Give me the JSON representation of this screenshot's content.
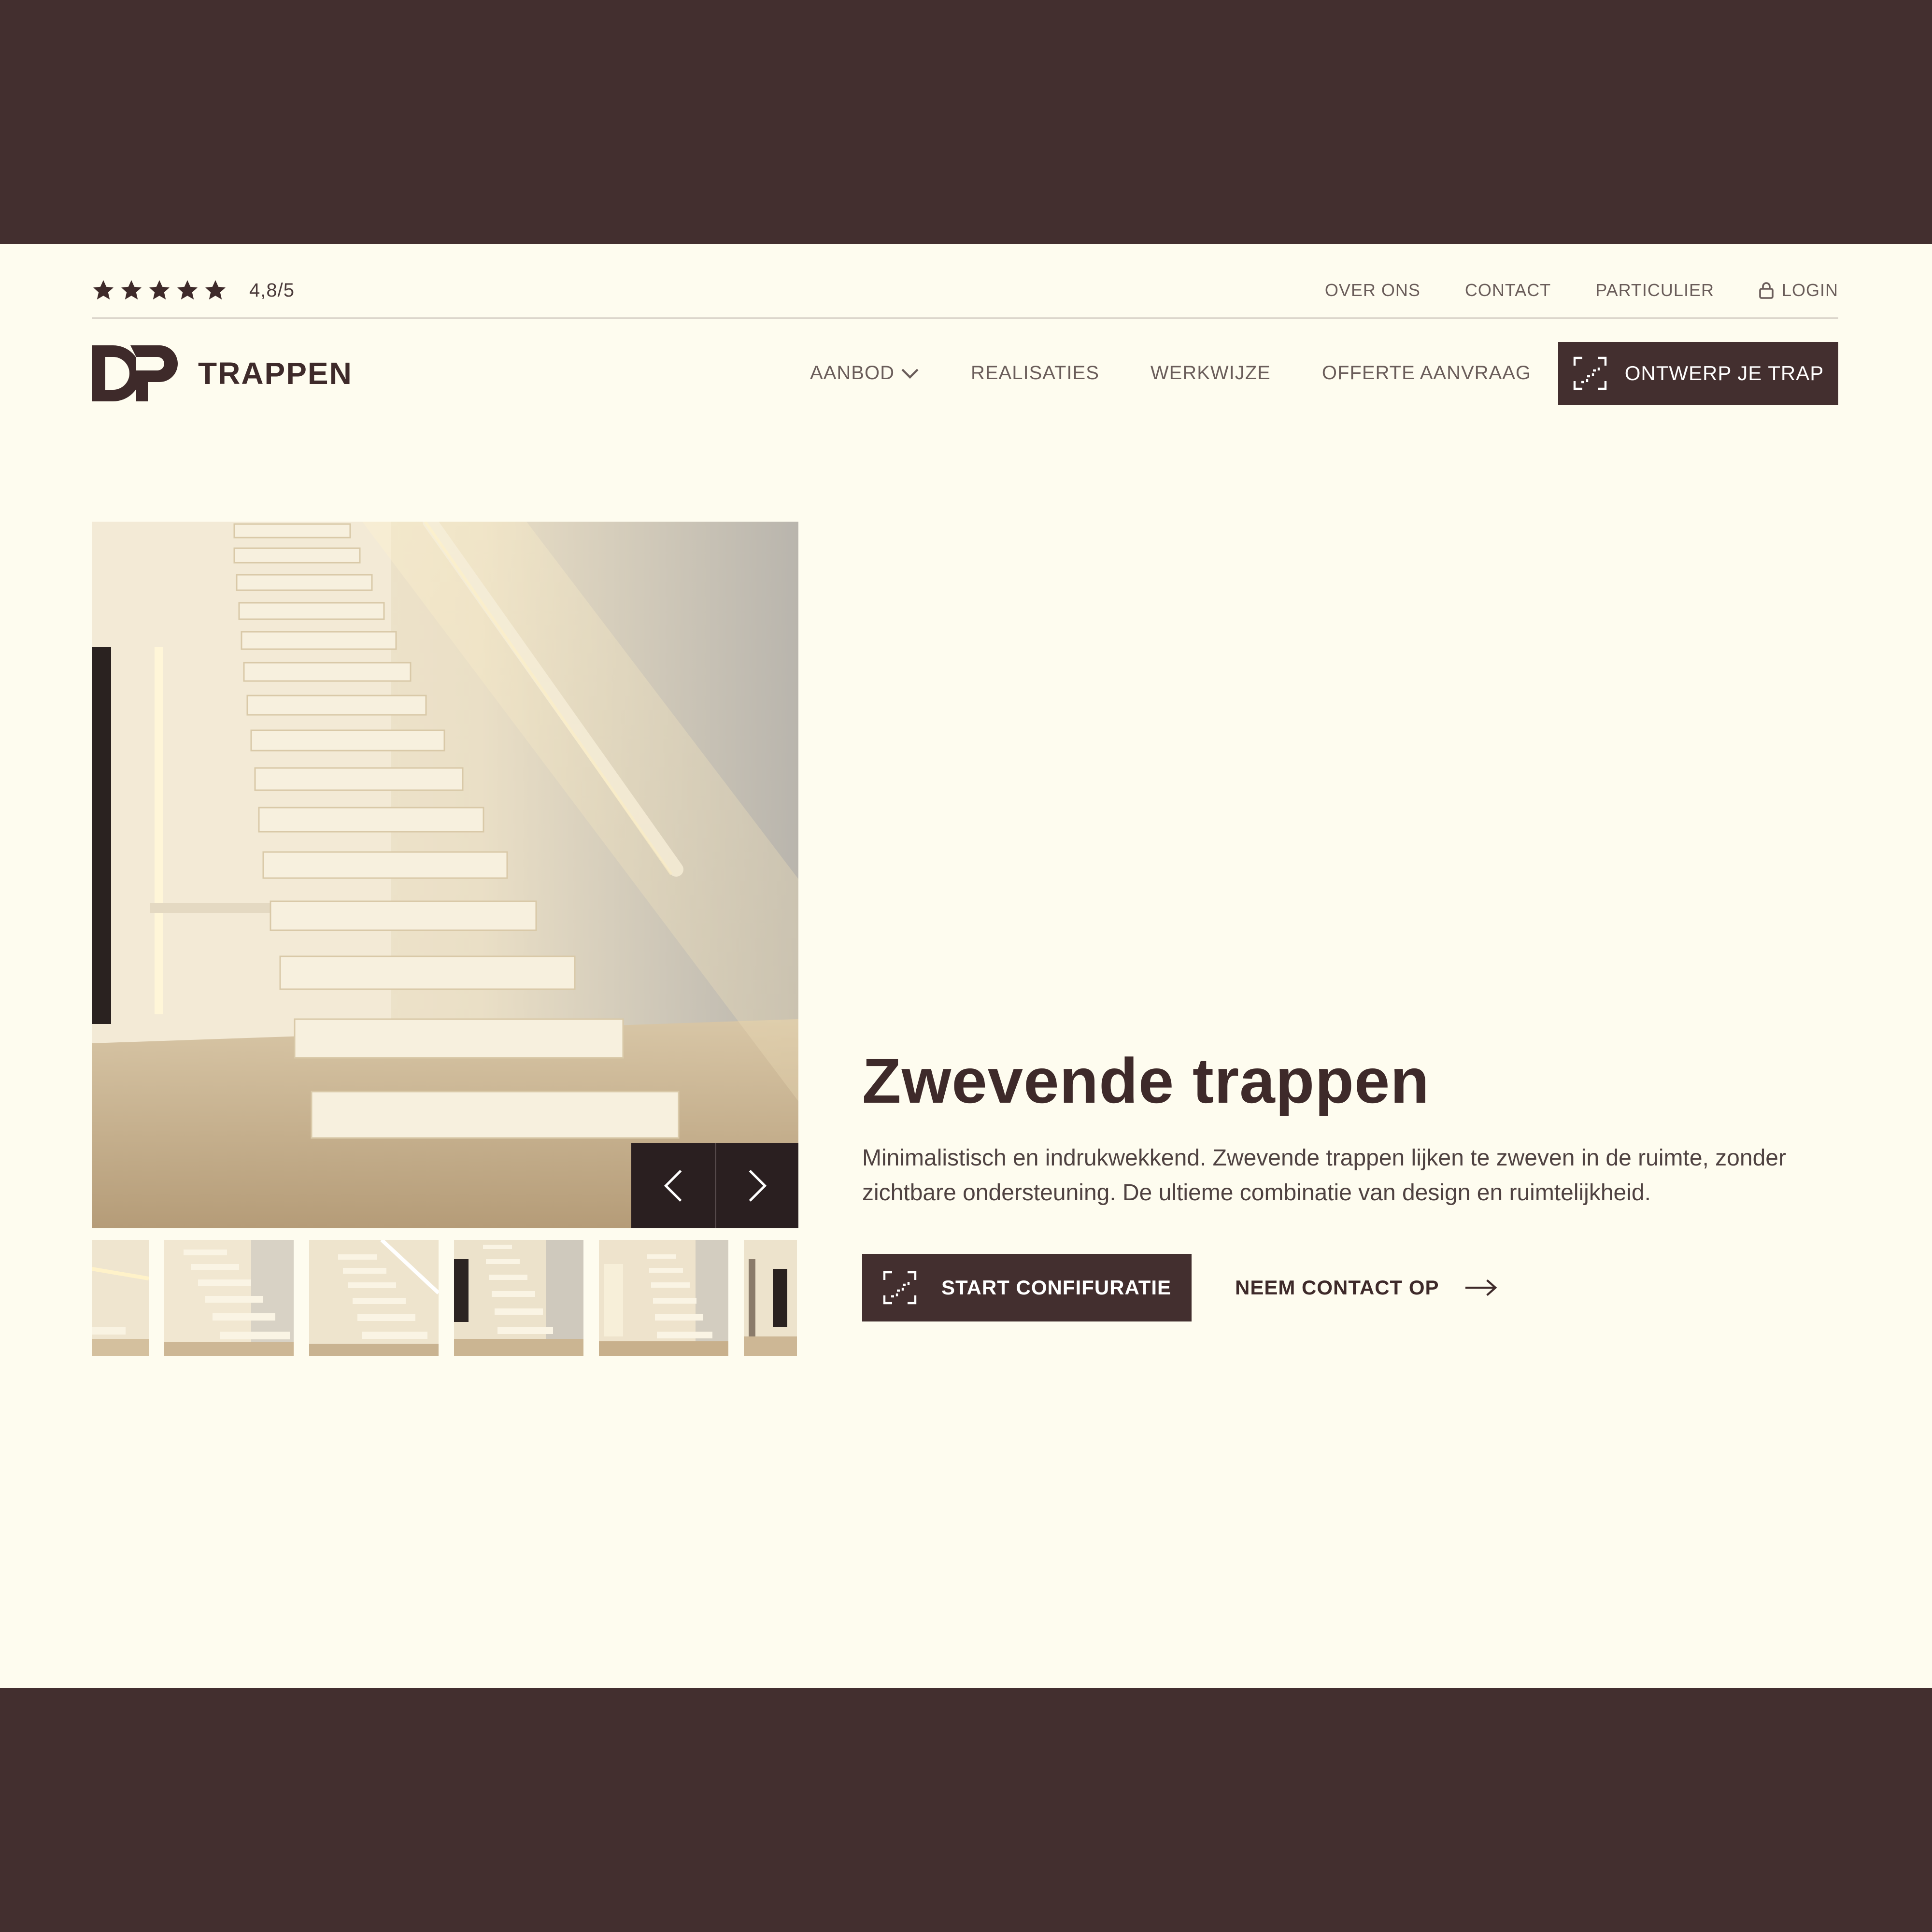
{
  "rating": {
    "value": "4,8/5",
    "stars": 5
  },
  "utility_nav": {
    "over_ons": "OVER ONS",
    "contact": "CONTACT",
    "particulier": "PARTICULIER",
    "login": "LOGIN"
  },
  "logo": {
    "text": "TRAPPEN"
  },
  "main_nav": {
    "aanbod": "AANBOD",
    "realisaties": "REALISATIES",
    "werkwijze": "WERKWIJZE",
    "offerte": "OFFERTE AANVRAAG",
    "cta": "ONTWERP JE TRAP"
  },
  "hero": {
    "title": "Zwevende trappen",
    "description": "Minimalistisch en indrukwekkend. Zwevende trappen lijken te zweven in de ruimte, zonder zichtbare ondersteuning. De ultieme combinatie van design en ruimtelijkheid.",
    "primary_cta": "START CONFIFURATIE",
    "secondary_cta": "NEEM CONTACT OP"
  },
  "colors": {
    "brand_dark": "#432f2f",
    "background": "#fefcef",
    "text_muted": "#6a5d5a"
  }
}
